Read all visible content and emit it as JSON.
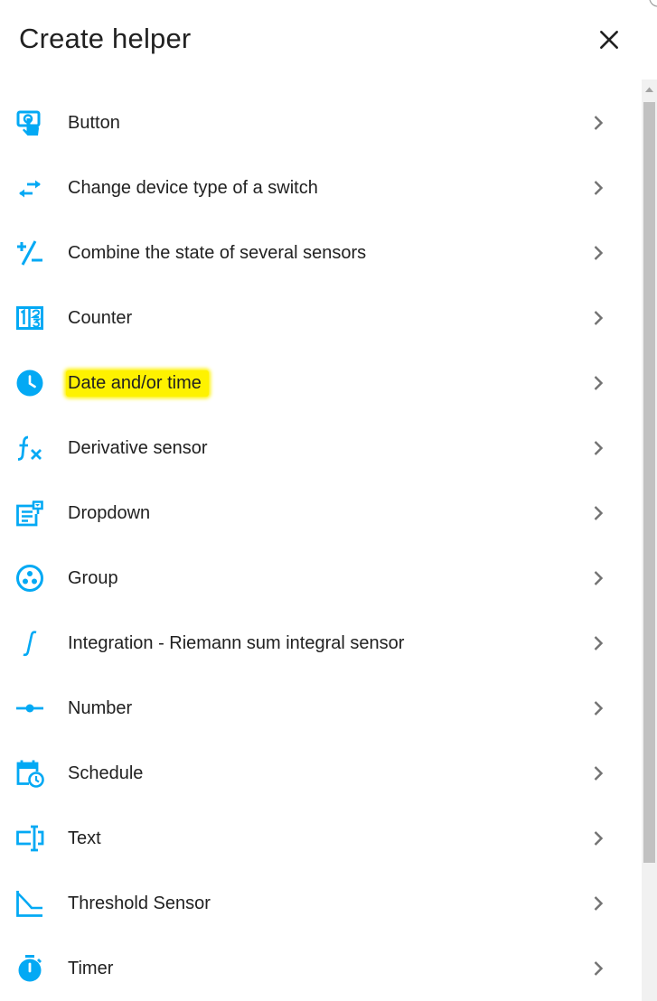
{
  "dialog": {
    "title": "Create helper",
    "close_icon": "close-icon"
  },
  "colors": {
    "icon": "#03a9f4",
    "highlight": "#fef200",
    "chevron": "#727272",
    "text": "#212121"
  },
  "items": [
    {
      "label": "Button",
      "icon": "gesture-tap-button-icon"
    },
    {
      "label": "Change device type of a switch",
      "icon": "swap-horizontal-icon"
    },
    {
      "label": "Combine the state of several sensors",
      "icon": "plus-minus-icon"
    },
    {
      "label": "Counter",
      "icon": "counter-icon"
    },
    {
      "label": "Date and/or time",
      "icon": "clock-icon",
      "highlighted": true
    },
    {
      "label": "Derivative sensor",
      "icon": "function-variant-icon"
    },
    {
      "label": "Dropdown",
      "icon": "form-dropdown-icon"
    },
    {
      "label": "Group",
      "icon": "group-icon"
    },
    {
      "label": "Integration - Riemann sum integral sensor",
      "icon": "integral-icon"
    },
    {
      "label": "Number",
      "icon": "ray-vertex-icon"
    },
    {
      "label": "Schedule",
      "icon": "calendar-clock-icon"
    },
    {
      "label": "Text",
      "icon": "form-textbox-icon"
    },
    {
      "label": "Threshold Sensor",
      "icon": "threshold-chart-icon"
    },
    {
      "label": "Timer",
      "icon": "timer-icon"
    }
  ]
}
